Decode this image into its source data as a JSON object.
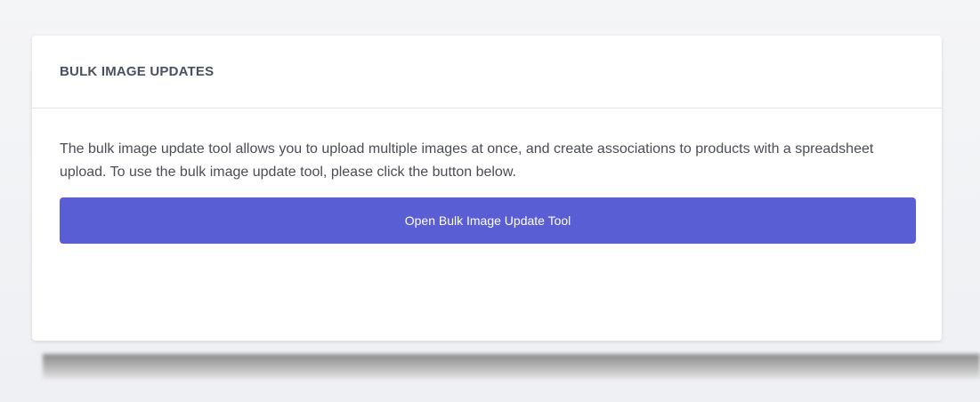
{
  "card": {
    "title": "BULK IMAGE UPDATES",
    "description": "The bulk image update tool allows you to upload multiple images at once, and create associations to products with a spreadsheet upload. To use the bulk image update tool, please click the button below.",
    "button_label": "Open Bulk Image Update Tool"
  },
  "colors": {
    "accent": "#5A5ED4",
    "card_background": "#FFFFFF",
    "page_background": "#F3F4F6",
    "text": "#4A4D57"
  }
}
